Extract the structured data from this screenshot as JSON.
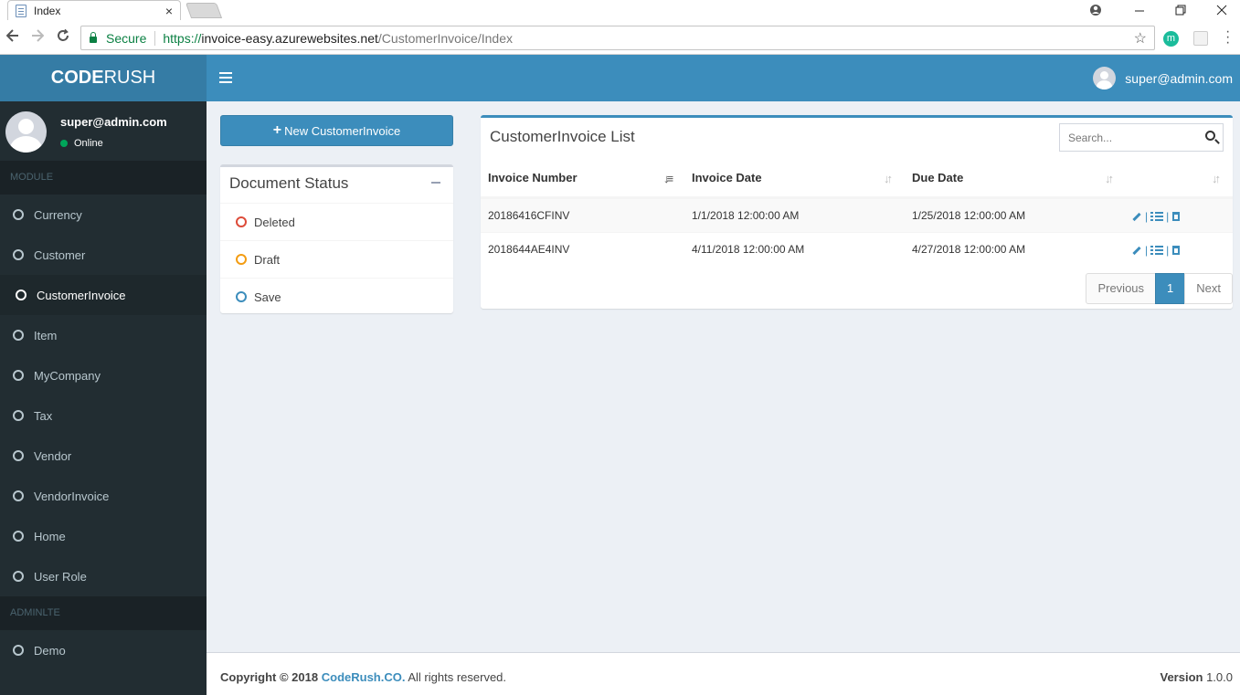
{
  "browser": {
    "tab_title": "Index",
    "tab_close": "×",
    "url_scheme": "https://",
    "url_host": "invoice-easy.azurewebsites.net",
    "url_path": "/CustomerInvoice/Index",
    "secure_label": "Secure",
    "ext_label": "m",
    "icons": [
      "back-icon",
      "forward-icon",
      "reload-icon",
      "lock-icon",
      "star-icon",
      "menu-icon"
    ]
  },
  "header": {
    "logo_bold": "CODE",
    "logo_rest": "RUSH",
    "user_email": "super@admin.com"
  },
  "sidebar": {
    "user_name": "super@admin.com",
    "user_status": "Online",
    "section_module": "MODULE",
    "items": [
      {
        "label": "Currency",
        "active": false
      },
      {
        "label": "Customer",
        "active": false
      },
      {
        "label": "CustomerInvoice",
        "active": true
      },
      {
        "label": "Item",
        "active": false
      },
      {
        "label": "MyCompany",
        "active": false
      },
      {
        "label": "Tax",
        "active": false
      },
      {
        "label": "Vendor",
        "active": false
      },
      {
        "label": "VendorInvoice",
        "active": false
      },
      {
        "label": "Home",
        "active": false
      },
      {
        "label": "User Role",
        "active": false
      }
    ],
    "section_adminlte": "ADMINLTE",
    "demo_label": "Demo"
  },
  "content": {
    "new_button": "New CustomerInvoice",
    "new_button_icon": "+",
    "status_box": {
      "title": "Document Status",
      "items": [
        {
          "label": "Deleted",
          "color": "#dd4b39"
        },
        {
          "label": "Draft",
          "color": "#f39c12"
        },
        {
          "label": "Save",
          "color": "#3c8dbc"
        }
      ]
    },
    "list_box": {
      "title": "CustomerInvoice List",
      "search_placeholder": "Search...",
      "columns": [
        "Invoice Number",
        "Invoice Date",
        "Due Date",
        ""
      ],
      "rows": [
        {
          "invoice_number": "20186416CFINV",
          "invoice_date": "1/1/2018 12:00:00 AM",
          "due_date": "1/25/2018 12:00:00 AM"
        },
        {
          "invoice_number": "2018644AE4INV",
          "invoice_date": "4/11/2018 12:00:00 AM",
          "due_date": "4/27/2018 12:00:00 AM"
        }
      ],
      "action_separator": "|",
      "pagination": {
        "previous": "Previous",
        "current": "1",
        "next": "Next"
      }
    }
  },
  "footer": {
    "copyright": "Copyright © 2018",
    "brand": "CodeRush.CO.",
    "rights": "All rights reserved.",
    "version_label": "Version",
    "version_value": "1.0.0"
  },
  "colors": {
    "primary": "#3c8dbc",
    "sidebar_bg": "#222d32",
    "logo_bg": "#357ca5"
  }
}
